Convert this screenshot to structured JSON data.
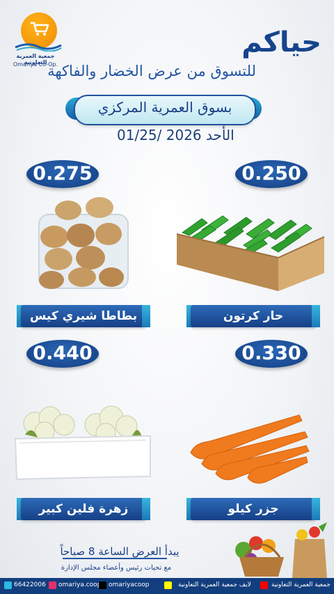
{
  "brand": {
    "name_ar": "جمعية العمرية التعاونية",
    "name_en": "Omariya Co-Op."
  },
  "header": {
    "greeting": "حياكم",
    "subtitle": "للتسوق من عرض الخضار والفاكهة",
    "market": "بسوق العمرية المركزي",
    "date": "الأحد 2026 /01/25"
  },
  "products": [
    {
      "name": "بطاطا شيري كيس",
      "price": "0.275"
    },
    {
      "name": "حار كرتون",
      "price": "0.250"
    },
    {
      "name": "زهرة فلين كبير",
      "price": "0.440"
    },
    {
      "name": "جزر كيلو",
      "price": "0.330"
    }
  ],
  "info": {
    "opening": "يبدأ العرض الساعة 8 صباحاً",
    "regards": "مع تحيات رئيس وأعضاء مجلس الإدارة"
  },
  "footer": {
    "phone": "66422006",
    "website": "omariya.coop",
    "x_handle": "omariyacoop",
    "snap": "لايف جمعية العمرية التعاونية",
    "youtube": "جمعية العمرية التعاونية"
  },
  "colors": {
    "primary": "#16448d",
    "accent": "#28a9d6",
    "logo": "#f08c00"
  }
}
